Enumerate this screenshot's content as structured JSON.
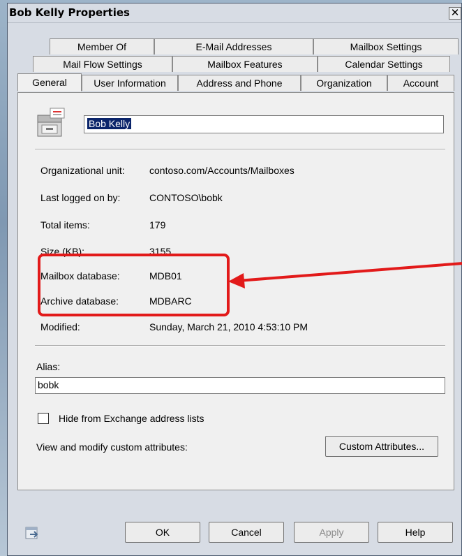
{
  "window": {
    "title": "Bob Kelly Properties",
    "close_glyph": "✕"
  },
  "tabs": {
    "row1": [
      "Member Of",
      "E-Mail Addresses",
      "Mailbox Settings"
    ],
    "row2": [
      "Mail Flow Settings",
      "Mailbox Features",
      "Calendar Settings"
    ],
    "row3": [
      "General",
      "User Information",
      "Address and Phone",
      "Organization",
      "Account"
    ]
  },
  "general": {
    "display_name": "Bob Kelly",
    "fields": [
      {
        "label": "Organizational unit:",
        "value": "contoso.com/Accounts/Mailboxes"
      },
      {
        "label": "Last logged on by:",
        "value": "CONTOSO\\bobk"
      },
      {
        "label": "Total items:",
        "value": "179"
      },
      {
        "label": "Size (KB):",
        "value": "3155"
      },
      {
        "label": "Mailbox database:",
        "value": "MDB01"
      },
      {
        "label": "Archive database:",
        "value": "MDBARC"
      },
      {
        "label": "Modified:",
        "value": "Sunday, March 21, 2010 4:53:10 PM"
      }
    ],
    "alias_label": "Alias:",
    "alias_value": "bobk",
    "hide_checkbox_label": "Hide from Exchange address lists",
    "hide_checked": false,
    "custom_attr_label": "View and modify custom attributes:",
    "custom_attr_button": "Custom Attributes..."
  },
  "buttons": {
    "ok": "OK",
    "cancel": "Cancel",
    "apply": "Apply",
    "help": "Help"
  },
  "annotation": {
    "callout_color": "#e21a1a"
  }
}
